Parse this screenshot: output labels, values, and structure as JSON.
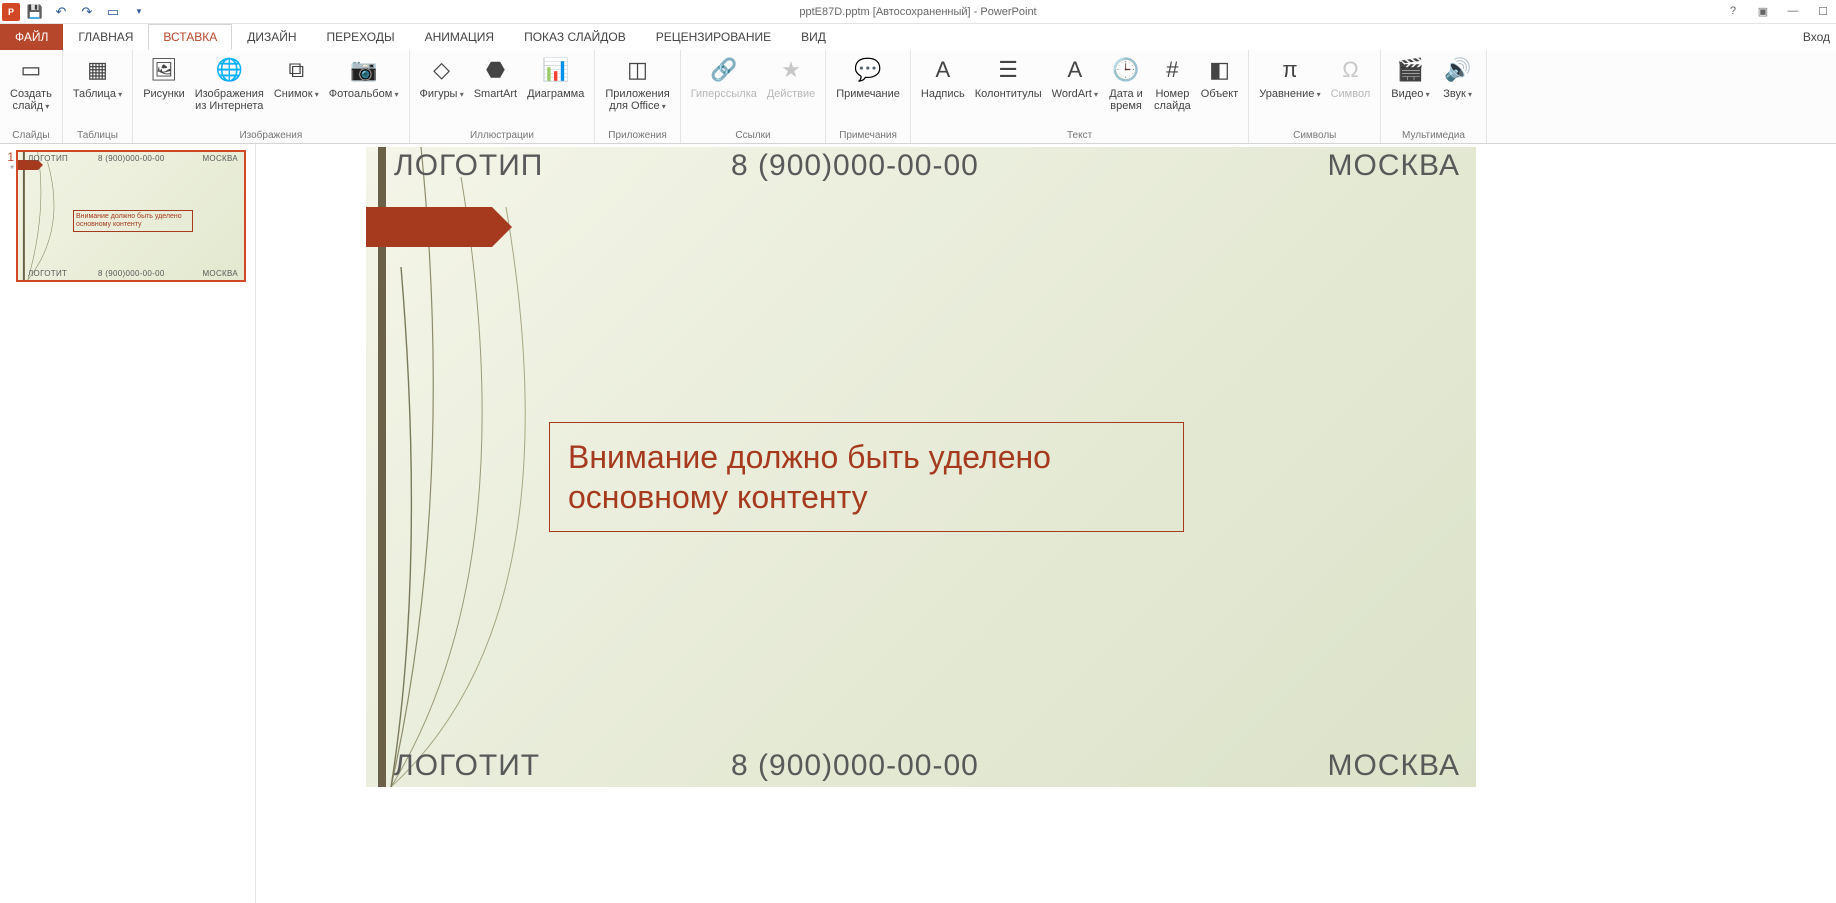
{
  "app": {
    "title": "pptE87D.pptm [Автосохраненный] - PowerPoint",
    "icon_text": "P",
    "signin": "Вход"
  },
  "qat": [
    "save",
    "undo",
    "redo",
    "start",
    "customize"
  ],
  "tabs": [
    "ФАЙЛ",
    "ГЛАВНАЯ",
    "ВСТАВКА",
    "ДИЗАЙН",
    "ПЕРЕХОДЫ",
    "АНИМАЦИЯ",
    "ПОКАЗ СЛАЙДОВ",
    "РЕЦЕНЗИРОВАНИЕ",
    "ВИД"
  ],
  "active_tab_index": 2,
  "ribbon": {
    "groups": [
      {
        "name": "Слайды",
        "buttons": [
          {
            "label": "Создать\nслайд",
            "icon": "new-slide",
            "drop": true
          }
        ]
      },
      {
        "name": "Таблицы",
        "buttons": [
          {
            "label": "Таблица",
            "icon": "table",
            "drop": true
          }
        ]
      },
      {
        "name": "Изображения",
        "buttons": [
          {
            "label": "Рисунки",
            "icon": "picture"
          },
          {
            "label": "Изображения\nиз Интернета",
            "icon": "online-pic"
          },
          {
            "label": "Снимок",
            "icon": "screenshot",
            "drop": true
          },
          {
            "label": "Фотоальбом",
            "icon": "photo-album",
            "drop": true
          }
        ]
      },
      {
        "name": "Иллюстрации",
        "buttons": [
          {
            "label": "Фигуры",
            "icon": "shapes",
            "drop": true
          },
          {
            "label": "SmartArt",
            "icon": "smartart"
          },
          {
            "label": "Диаграмма",
            "icon": "chart"
          }
        ]
      },
      {
        "name": "Приложения",
        "buttons": [
          {
            "label": "Приложения\nдля Office",
            "icon": "apps",
            "drop": true
          }
        ]
      },
      {
        "name": "Ссылки",
        "buttons": [
          {
            "label": "Гиперссылка",
            "icon": "hyperlink",
            "disabled": true
          },
          {
            "label": "Действие",
            "icon": "action",
            "disabled": true
          }
        ]
      },
      {
        "name": "Примечания",
        "buttons": [
          {
            "label": "Примечание",
            "icon": "comment"
          }
        ]
      },
      {
        "name": "Текст",
        "buttons": [
          {
            "label": "Надпись",
            "icon": "textbox"
          },
          {
            "label": "Колонтитулы",
            "icon": "header-footer"
          },
          {
            "label": "WordArt",
            "icon": "wordart",
            "drop": true
          },
          {
            "label": "Дата и\nвремя",
            "icon": "date-time"
          },
          {
            "label": "Номер\nслайда",
            "icon": "slide-number"
          },
          {
            "label": "Объект",
            "icon": "object"
          }
        ]
      },
      {
        "name": "Символы",
        "buttons": [
          {
            "label": "Уравнение",
            "icon": "equation",
            "drop": true
          },
          {
            "label": "Символ",
            "icon": "symbol",
            "disabled": true
          }
        ]
      },
      {
        "name": "Мультимедиа",
        "buttons": [
          {
            "label": "Видео",
            "icon": "video",
            "drop": true
          },
          {
            "label": "Звук",
            "icon": "audio",
            "drop": true
          }
        ]
      }
    ]
  },
  "thumb": {
    "number": "1",
    "star": "*",
    "top_left": "ЛОГОТИП",
    "top_center": "8 (900)000-00-00",
    "top_right": "МОСКВА",
    "box": "Внимание должно быть\nуделено основному контенту",
    "bot_left": "ЛОГОТИТ",
    "bot_center": "8 (900)000-00-00",
    "bot_right": "МОСКВА"
  },
  "slide": {
    "top_left": "ЛОГОТИП",
    "top_center": "8 (900)000-00-00",
    "top_right": "МОСКВА",
    "content": "Внимание должно быть уделено основному контенту",
    "bot_left": "ЛОГОТИТ",
    "bot_center": "8 (900)000-00-00",
    "bot_right": "МОСКВА"
  },
  "icons": {
    "new-slide": "▭",
    "table": "▦",
    "picture": "🖼",
    "online-pic": "🌐",
    "screenshot": "⧉",
    "photo-album": "📷",
    "shapes": "◇",
    "smartart": "⬣",
    "chart": "📊",
    "apps": "◫",
    "hyperlink": "🔗",
    "action": "★",
    "comment": "💬",
    "textbox": "A",
    "header-footer": "☰",
    "wordart": "A",
    "date-time": "🕒",
    "slide-number": "#",
    "object": "◧",
    "equation": "π",
    "symbol": "Ω",
    "video": "🎬",
    "audio": "🔊"
  }
}
